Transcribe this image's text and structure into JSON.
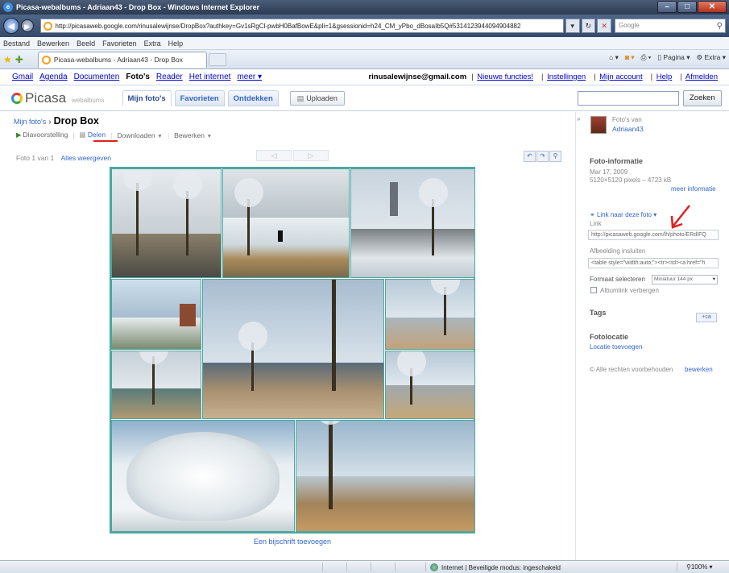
{
  "window": {
    "title": "Picasa-webalbums - Adriaan43 - Drop Box - Windows Internet Explorer",
    "address": "http://picasaweb.google.com/rinusalewijnse/DropBox?authkey=Gv1sRgCl-pwbH0BafBowE&pli=1&gsessionid=h24_CM_yPbo_dBosaIb5Q#5314123944094904882",
    "search_placeholder": "Google"
  },
  "menu": [
    "Bestand",
    "Bewerken",
    "Beeld",
    "Favorieten",
    "Extra",
    "Help"
  ],
  "tab": {
    "label": "Picasa-webalbums - Adriaan43 - Drop Box"
  },
  "commandbar": {
    "page": "Pagina",
    "extra": "Extra"
  },
  "gbar": {
    "links": [
      "Gmail",
      "Agenda",
      "Documenten"
    ],
    "current": "Foto's",
    "links2": [
      "Reader",
      "Het internet",
      "meer ▾"
    ],
    "email": "rinusalewijnse@gmail.com",
    "right_links": [
      "Nieuwe functies!",
      "Instellingen",
      "Mijn account",
      "Help",
      "Afmelden"
    ]
  },
  "picasa": {
    "logo": "Picasa",
    "logo_sub": "webalbums",
    "tabs": [
      "Mijn foto's",
      "Favorieten",
      "Ontdekken"
    ],
    "upload": "Uploaden",
    "search_button": "Zoeken"
  },
  "album": {
    "breadcrumb_link": "Mijn foto's",
    "breadcrumb_sep": "›",
    "title": "Drop Box",
    "actions": [
      "Diavoorstelling",
      "Delen",
      "Downloaden",
      "Bewerken"
    ],
    "photo_position": "Foto 1 van 1",
    "show_all": "Alles weergeven",
    "caption_link": "Een bijschrift toevoegen"
  },
  "sidebar": {
    "owner_label": "Foto's van",
    "owner_name": "Adriaan43",
    "info_head": "Foto-informatie",
    "date": "Mar 17, 2009",
    "dimensions": "5120×5120 pixels – 4723 kB",
    "more_info": "meer informatie",
    "link_head": "Link naar deze foto",
    "link_label": "Link",
    "link_value": "http://picasaweb.google.com/lh/photo/ERdIFQ",
    "embed_label": "Afbeelding insluiten",
    "embed_value": "<table style=\"width:auto;\"><tr><td><a href=\"h",
    "format_label": "Formaat selecteren",
    "format_value": "Miniatuur 144 px",
    "hide_thumb": "Albumlink verbergen",
    "tags_head": "Tags",
    "tags_add": "+ca",
    "location_head": "Fotolocatie",
    "location_add": "Locatie toevoegen",
    "rights": "Alle rechten voorbehouden",
    "rights_edit": "bewerken"
  },
  "status": {
    "zone": "Internet | Beveiligde modus: ingeschakeld",
    "zoom": "100%"
  }
}
